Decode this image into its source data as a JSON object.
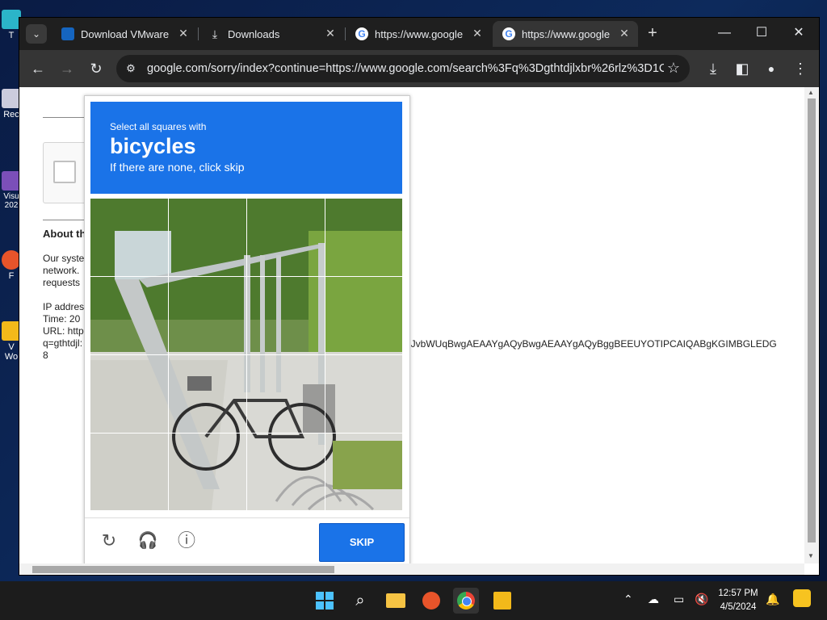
{
  "desktop": {
    "icons": [
      {
        "label": "T"
      },
      {
        "label": "Rec"
      },
      {
        "label": "Visu"
      },
      {
        "label": "202"
      },
      {
        "label": "F"
      },
      {
        "label": "V"
      },
      {
        "label": "Wo"
      }
    ]
  },
  "browser": {
    "tabs": [
      {
        "title": "Download VMware W",
        "favicon": "vmware-icon"
      },
      {
        "title": "Downloads",
        "favicon": "download-icon"
      },
      {
        "title": "https://www.google.c",
        "favicon": "google-icon"
      },
      {
        "title": "https://www.google.c",
        "favicon": "google-icon",
        "active": true
      }
    ],
    "new_tab": "+",
    "window_controls": {
      "minimize": "—",
      "maximize": "☐",
      "close": "✕"
    },
    "toolbar": {
      "back": "←",
      "forward": "→",
      "reload": "↻",
      "url": "google.com/sorry/index?continue=https://www.google.com/search%3Fq%3Dgthtdjlxbr%26rlz%3D1C...",
      "bookmark": "☆",
      "download": "⤓",
      "sidepanel": "◧",
      "profile": "●",
      "menu": "⋮"
    }
  },
  "page": {
    "about": "About th",
    "para": [
      "Our syste",
      "network.",
      "requests"
    ],
    "ip_label": "IP addres",
    "time_label": "Time: 20",
    "url_label": "URL: http",
    "q_line": "q=gthtdjl:",
    "eight": "8",
    "long_token": "lJvbWUqBwgAEAAYgAQyBwgAEAAYgAQyBggBEEUYOTIPCAIQABgKGIMBGLEDG"
  },
  "captcha": {
    "instruction_small": "Select all squares with",
    "target": "bicycles",
    "instruction_sub": "If there are none, click skip",
    "skip_label": "SKIP",
    "reload_icon": "↻",
    "audio_icon": "🎧",
    "info_icon": "ⓘ"
  },
  "taskbar": {
    "clock_time": "12:57 PM",
    "clock_date": "4/5/2024"
  },
  "colors": {
    "accent_blue": "#1a73e8",
    "tab_bar": "#1f1f1f",
    "toolbar": "#353535"
  }
}
